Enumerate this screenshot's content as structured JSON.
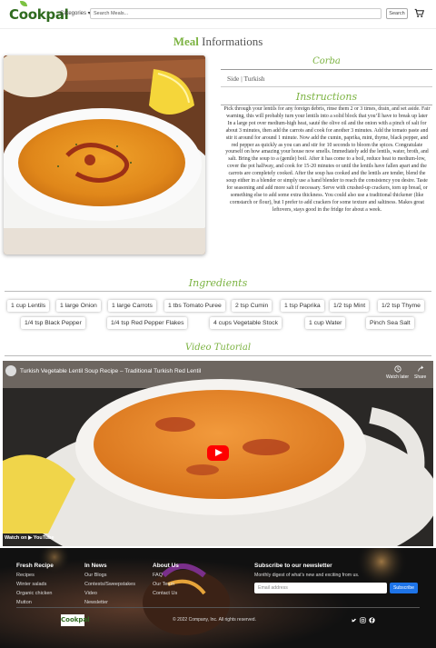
{
  "nav": {
    "logo": "Cookpal",
    "categories_label": "Categories ▾",
    "search_placeholder": "Search Meals...",
    "search_button": "Search"
  },
  "page": {
    "title_accent": "Meal",
    "title_rest": " Informations"
  },
  "meal": {
    "name": "Corba",
    "meta": "Side | Turkish",
    "instructions_heading": "Instructions",
    "instructions": "Pick through your lentils for any foreign debris, rinse them 2 or 3 times, drain, and set aside. Fair warning, this will probably turn your lentils into a solid block that you’ll have to break up later In a large pot over medium-high heat, sauté the olive oil and the onion with a pinch of salt for about 3 minutes, then add the carrots and cook for another 3 minutes. Add the tomato paste and stir it around for around 1 minute. Now add the cumin, paprika, mint, thyme, black pepper, and red pepper as quickly as you can and stir for 10 seconds to bloom the spices. Congratulate yourself on how amazing your house now smells. Immediately add the lentils, water, broth, and salt. Bring the soup to a (gentle) boil. After it has come to a boil, reduce heat to medium-low, cover the pot halfway, and cook for 15-20 minutes or until the lentils have fallen apart and the carrots are completely cooked. After the soup has cooked and the lentils are tender, blend the soup either in a blender or simply use a hand blender to reach the consistency you desire. Taste for seasoning and add more salt if necessary. Serve with crushed-up crackers, torn up bread, or something else to add some extra thickness. You could also use a traditional thickener (like cornstarch or flour), but I prefer to add crackers for some texture and saltiness. Makes great leftovers, stays good in the fridge for about a week."
  },
  "ingredients": {
    "heading": "Ingredients",
    "items": [
      "1 cup Lentils",
      "1 large Onion",
      "1 large Carrots",
      "1 tbs Tomato Puree",
      "2 tsp Cumin",
      "1 tsp Paprika",
      "1/2 tsp Mint",
      "1/2 tsp Thyme",
      "1/4 tsp Black Pepper",
      "1/4 tsp Red Pepper Flakes",
      "4 cups Vegetable Stock",
      "1 cup Water",
      "Pinch Sea Salt"
    ]
  },
  "video": {
    "heading": "Video Tutorial",
    "title": "Turkish Vegetable Lentil Soup Recipe – Traditional Turkish Red Lentil",
    "watch_later": "Watch later",
    "share": "Share",
    "watch_on": "Watch on ▶ YouTube"
  },
  "footer": {
    "cols": [
      {
        "heading": "Fresh Recipe",
        "links": [
          "Recipes",
          "Winter salads",
          "Organic chicken",
          "Mutton"
        ]
      },
      {
        "heading": "In News",
        "links": [
          "Our Blogs",
          "Contests/Sweepstakes",
          "Video",
          "Newsletter"
        ]
      },
      {
        "heading": "About Us",
        "links": [
          "FAQ",
          "Our Team",
          "Contact Us"
        ]
      }
    ],
    "newsletter_heading": "Subscribe to our newsletter",
    "newsletter_text": "Monthly digest of what's new and exciting from us.",
    "email_placeholder": "Email address",
    "subscribe": "Subscribe",
    "copyright": "© 2022 Company, Inc. All rights reserved.",
    "logo": "Cookpal"
  },
  "colors": {
    "accent": "#7cb342",
    "brand_dark": "#2f6b1f",
    "youtube_red": "#ff0000",
    "subscribe_blue": "#1e74e8"
  }
}
